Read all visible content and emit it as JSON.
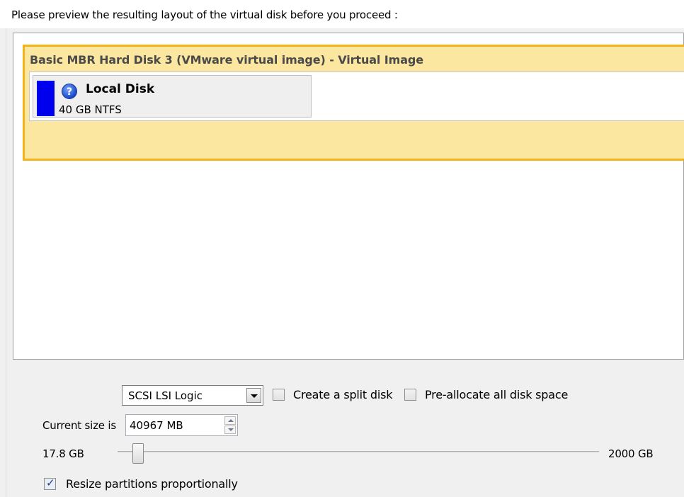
{
  "header": {
    "instruction": "Please preview the resulting layout of the virtual disk before you proceed :"
  },
  "disk": {
    "title": "Basic MBR Hard Disk 3 (VMware virtual image) - Virtual Image",
    "partition": {
      "label": "Local Disk",
      "size": "40 GB NTFS",
      "icon": "help-icon",
      "color": "#0000ee"
    },
    "highlight_color": "#f4b31b"
  },
  "options": {
    "controller_selected": "SCSI LSI Logic",
    "split_disk_label": "Create a split disk",
    "split_disk_checked": false,
    "preallocate_label": "Pre-allocate all disk space",
    "preallocate_checked": false
  },
  "size": {
    "current_label": "Current size is",
    "current_value": "40967 MB",
    "slider_min_label": "17.8 GB",
    "slider_max_label": "2000 GB",
    "slider_value_gb": 40
  },
  "resize": {
    "label": "Resize partitions proportionally",
    "checked": true
  }
}
